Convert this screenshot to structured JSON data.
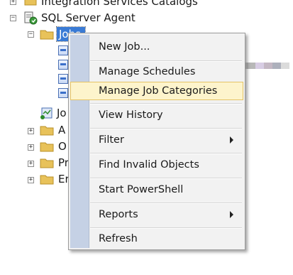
{
  "tree": {
    "integration_catalogs": "Integration Services Catalogs",
    "agent": "SQL Server Agent",
    "jobs": "Jobs",
    "job_activity_partial": "Jo",
    "folders_partial": [
      "A",
      "O",
      "Pr",
      "Er"
    ]
  },
  "context_menu": {
    "items": [
      {
        "label": "New Job..."
      },
      {
        "label": "Manage Schedules"
      },
      {
        "label": "Manage Job Categories",
        "highlighted": true
      },
      {
        "label": "View History"
      },
      {
        "label": "Filter",
        "submenu": true
      },
      {
        "label": "Find Invalid Objects"
      },
      {
        "label": "Start PowerShell"
      },
      {
        "label": "Reports",
        "submenu": true
      },
      {
        "label": "Refresh"
      }
    ]
  },
  "colors": {
    "selection": "#3a7bd5",
    "menu_bg": "#f2f2f2",
    "menu_gutter": "#c5d1e5",
    "highlight_bg": "#fdf4cc",
    "highlight_border": "#e5c365",
    "folder": "#e8c25a"
  }
}
